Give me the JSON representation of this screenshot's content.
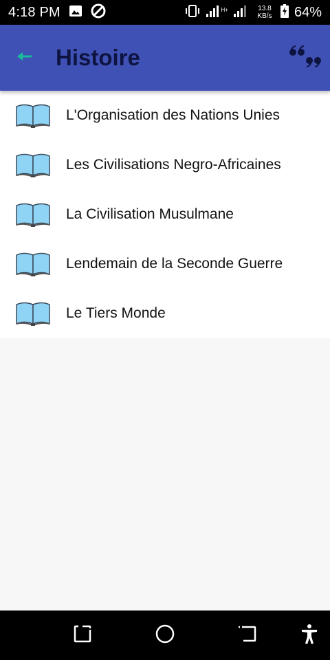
{
  "status_bar": {
    "time": "4:18 PM",
    "network_speed_value": "13.8",
    "network_speed_unit": "KB/s",
    "battery_percent": "64%",
    "network_type": "H+"
  },
  "app_bar": {
    "title": "Histoire",
    "background_color": "#3f51b5",
    "back_icon": "arrow-back-icon",
    "back_icon_color": "#1abc9c",
    "action_icon": "quote-icon"
  },
  "topics": [
    {
      "label": "L'Organisation des Nations Unies",
      "icon": "open-book-icon"
    },
    {
      "label": "Les Civilisations Negro-Africaines",
      "icon": "open-book-icon"
    },
    {
      "label": "La Civilisation Musulmane",
      "icon": "open-book-icon"
    },
    {
      "label": "Lendemain de la Seconde Guerre",
      "icon": "open-book-icon"
    },
    {
      "label": "Le Tiers Monde",
      "icon": "open-book-icon"
    }
  ],
  "nav_bar": {
    "buttons": [
      "recents-icon",
      "home-icon",
      "back-icon",
      "accessibility-icon"
    ]
  }
}
